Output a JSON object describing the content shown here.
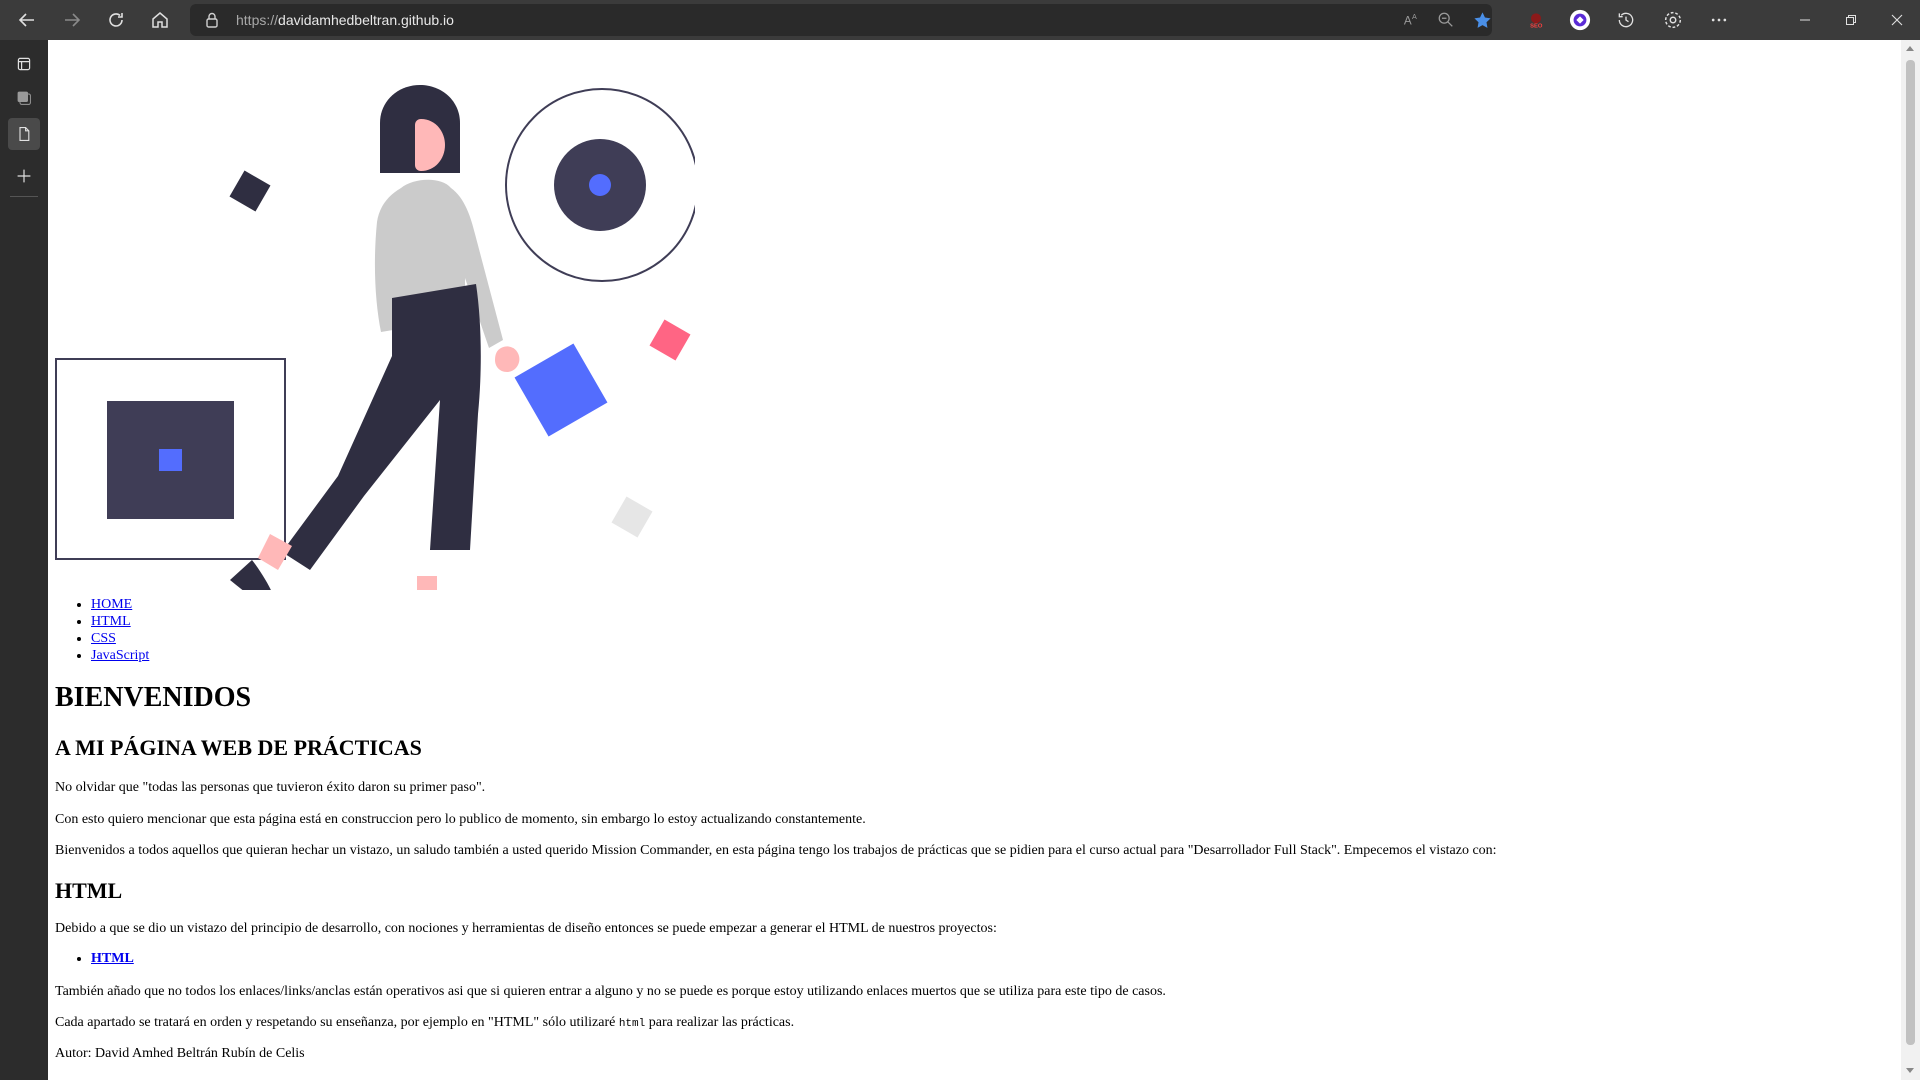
{
  "browser": {
    "url_prefix": "https://",
    "url_host": "davidamhedbeltran.github.io",
    "icons": [
      "back-arrow-icon",
      "forward-arrow-icon",
      "refresh-icon",
      "home-icon",
      "lock-icon",
      "read-aloud-icon",
      "zoom-out-icon",
      "favorite-star-icon",
      "seo-extension-icon",
      "extension-icon",
      "history-icon",
      "settings-icon",
      "more-icon",
      "minimize-icon",
      "restore-icon",
      "close-icon"
    ],
    "accent_color": "#4a8fe7"
  },
  "sidebar": {
    "icons": [
      "tab-actions-icon",
      "collections-icon",
      "page-icon",
      "add-icon"
    ]
  },
  "hero": {
    "colors": {
      "dark": "#2f2e41",
      "navy": "#3f3d56",
      "blue": "#536dfe",
      "pink": "#ff6584",
      "gray": "#cbcbcb",
      "light_gray": "#e6e6e6",
      "skin": "#ffb8b8"
    }
  },
  "menu": {
    "items": [
      "HOME",
      "HTML",
      "CSS",
      "JavaScript"
    ]
  },
  "content": {
    "h1": "BIENVENIDOS",
    "h2": "A MI PÁGINA WEB DE PRÁCTICAS",
    "p1": "No olvidar que \"todas las personas que tuvieron éxito daron su primer paso\".",
    "p2": "Con esto quiero mencionar que esta página está en construccion pero lo publico de momento, sin embargo lo estoy actualizando constantemente.",
    "p3": "Bienvenidos a todos aquellos que quieran hechar un vistazo, un saludo también a usted querido Mission Commander, en esta página tengo los trabajos de prácticas que se pidien para el curso actual para \"Desarrollador Full Stack\". Empecemos el vistazo con:",
    "h2_html": "HTML",
    "p4": "Debido a que se dio un vistazo del principio de desarrollo, con nociones y herramientas de diseño entonces se puede empezar a generar el HTML de nuestros proyectos:",
    "sub_link": "HTML",
    "p5": "También añado que no todos los enlaces/links/anclas están operativos asi que si quieren entrar a alguno y no se puede es porque estoy utilizando enlaces muertos que se utiliza para este tipo de casos.",
    "p6_before": "Cada apartado se tratará en orden y respetando su enseñanza, por ejemplo en \"HTML\" sólo utilizaré ",
    "p6_code": "html",
    "p6_after": " para realizar las prácticas.",
    "author": "Autor: David Amhed Beltrán Rubín de Celis"
  }
}
